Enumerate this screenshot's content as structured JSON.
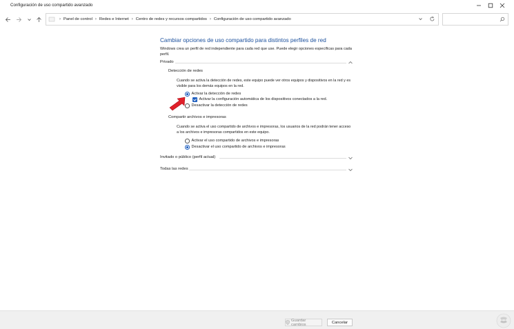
{
  "window": {
    "title": "Configuración de uso compartido avanzado"
  },
  "addressbar": {
    "breadcrumbs": [
      "Panel de control",
      "Redes e Internet",
      "Centro de redes y recursos compartidos",
      "Configuración de uso compartido avanzado"
    ]
  },
  "search": {
    "placeholder": ""
  },
  "main": {
    "title": "Cambiar opciones de uso compartido para distintos perfiles de red",
    "description": "Windows crea un perfil de red independiente para cada red que use. Puede elegir opciones específicas para cada perfil."
  },
  "profiles": {
    "private": {
      "label": "Privado",
      "network_discovery": {
        "title": "Detección de redes",
        "description": "Cuando se activa la detección de redes, este equipo puede ver otros equipos y dispositivos en la red y es visible para los demás equipos en la red.",
        "option_on": "Activar la detección de redes",
        "option_auto": "Activar la configuración automática de los dispositivos conectados a la red.",
        "option_off": "Desactivar la detección de redes",
        "selected": "on",
        "auto_checked": true
      },
      "file_sharing": {
        "title": "Compartir archivos e impresoras",
        "description": "Cuando se activa el uso compartido de archivos e impresoras, los usuarios de la red podrán tener acceso a los archivos e impresoras compartidos en este equipo.",
        "option_on": "Activar el uso compartido de archivos e impresoras",
        "option_off": "Desactivar el uso compartido de archivos e impresoras",
        "selected": "off"
      }
    },
    "guest": {
      "label": "Invitado o público (perfil actual)"
    },
    "all": {
      "label": "Todas las redes"
    }
  },
  "footer": {
    "save_label": "Guardar cambios",
    "cancel_label": "Cancelar"
  },
  "colors": {
    "accent": "#1f5fbf",
    "title_blue": "#1a4f9c",
    "arrow_red": "#e0202a"
  },
  "icons": {
    "back": "arrow-left-icon",
    "forward": "arrow-right-icon",
    "recent": "chevron-down-icon",
    "up": "arrow-up-icon",
    "refresh": "refresh-icon",
    "search": "search-icon",
    "shield": "uac-shield-icon"
  }
}
